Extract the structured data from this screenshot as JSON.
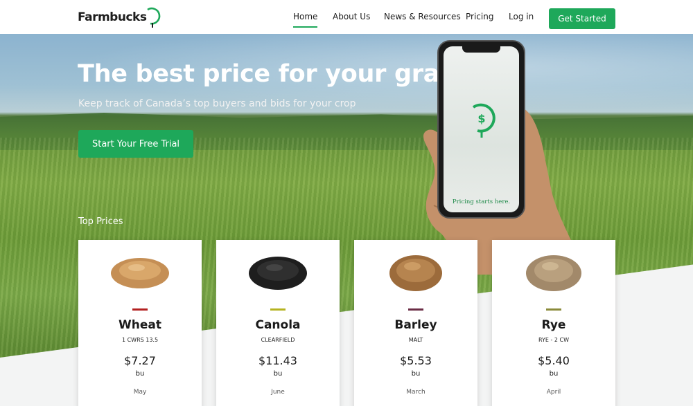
{
  "brand": {
    "name": "Farmbucks",
    "logo_icon": "dollar-compass-icon",
    "accent": "#1ea85a"
  },
  "nav": {
    "items": [
      {
        "label": "Home",
        "active": true
      },
      {
        "label": "About Us",
        "active": false
      },
      {
        "label": "News & Resources",
        "active": false
      },
      {
        "label": "Pricing",
        "active": false
      },
      {
        "label": "Log in",
        "active": false
      }
    ],
    "cta_label": "Get Started"
  },
  "hero": {
    "title": "The best price for your grain",
    "subtitle": "Keep track of Canada’s top buyers and bids for your crop",
    "button_label": "Start Your Free Trial",
    "phone_caption": "Pricing starts here."
  },
  "top_prices": {
    "heading": "Top Prices",
    "cards": [
      {
        "name": "Wheat",
        "grade": "1 CWRS 13.5",
        "price": "$7.27",
        "unit": "bu",
        "month": "May",
        "color": "#b32020"
      },
      {
        "name": "Canola",
        "grade": "CLEARFIELD",
        "price": "$11.43",
        "unit": "bu",
        "month": "June",
        "color": "#b5b320"
      },
      {
        "name": "Barley",
        "grade": "MALT",
        "price": "$5.53",
        "unit": "bu",
        "month": "March",
        "color": "#6a2c45"
      },
      {
        "name": "Rye",
        "grade": "RYE - 2 CW",
        "price": "$5.40",
        "unit": "bu",
        "month": "April",
        "color": "#8a8a3a"
      }
    ]
  }
}
